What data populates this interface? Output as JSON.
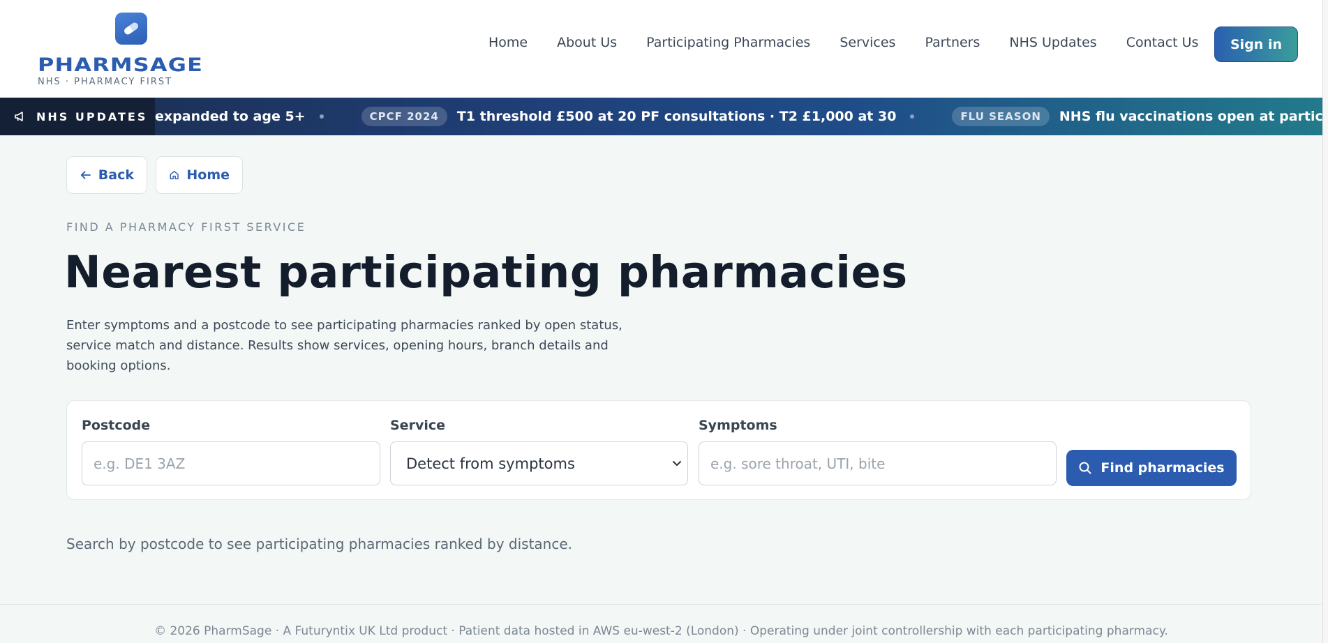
{
  "brand": {
    "name": "PHARMSAGE",
    "tagline": "NHS · PHARMACY FIRST",
    "logo_icon": "pill-icon",
    "primary_color": "#2b5cb0",
    "accent_color": "#3a9d9a"
  },
  "nav": {
    "items": [
      {
        "label": "Home"
      },
      {
        "label": "About Us"
      },
      {
        "label": "Participating Pharmacies"
      },
      {
        "label": "Services"
      },
      {
        "label": "Partners"
      },
      {
        "label": "NHS Updates"
      },
      {
        "label": "Contact Us"
      }
    ],
    "signin_label": "Sign in"
  },
  "ticker": {
    "label": "NHS UPDATES",
    "icon": "megaphone-icon",
    "items": [
      {
        "badge": "",
        "text": "expanded to age 5+"
      },
      {
        "badge": "CPCF 2024",
        "text": "T1 threshold £500 at 20 PF consultations · T2 £1,000 at 30"
      },
      {
        "badge": "FLU SEASON",
        "text": "NHS flu vaccinations open at participating pharmacies — book"
      }
    ]
  },
  "actions": {
    "back_label": "Back",
    "home_label": "Home"
  },
  "page": {
    "eyebrow": "FIND A PHARMACY FIRST SERVICE",
    "title": "Nearest participating pharmacies",
    "description": "Enter symptoms and a postcode to see participating pharmacies ranked by open status, service match and distance. Results show services, opening hours, branch details and booking options."
  },
  "search": {
    "postcode_label": "Postcode",
    "postcode_placeholder": "e.g. DE1 3AZ",
    "postcode_value": "",
    "service_label": "Service",
    "service_selected": "Detect from symptoms",
    "symptoms_label": "Symptoms",
    "symptoms_placeholder": "e.g. sore throat, UTI, bite",
    "symptoms_value": "",
    "button_label": "Find pharmacies"
  },
  "hint": "Search by postcode to see participating pharmacies ranked by distance.",
  "footer": "© 2026 PharmSage · A Futuryntix UK Ltd product · Patient data hosted in AWS eu-west-2 (London) · Operating under joint controllership with each participating pharmacy."
}
